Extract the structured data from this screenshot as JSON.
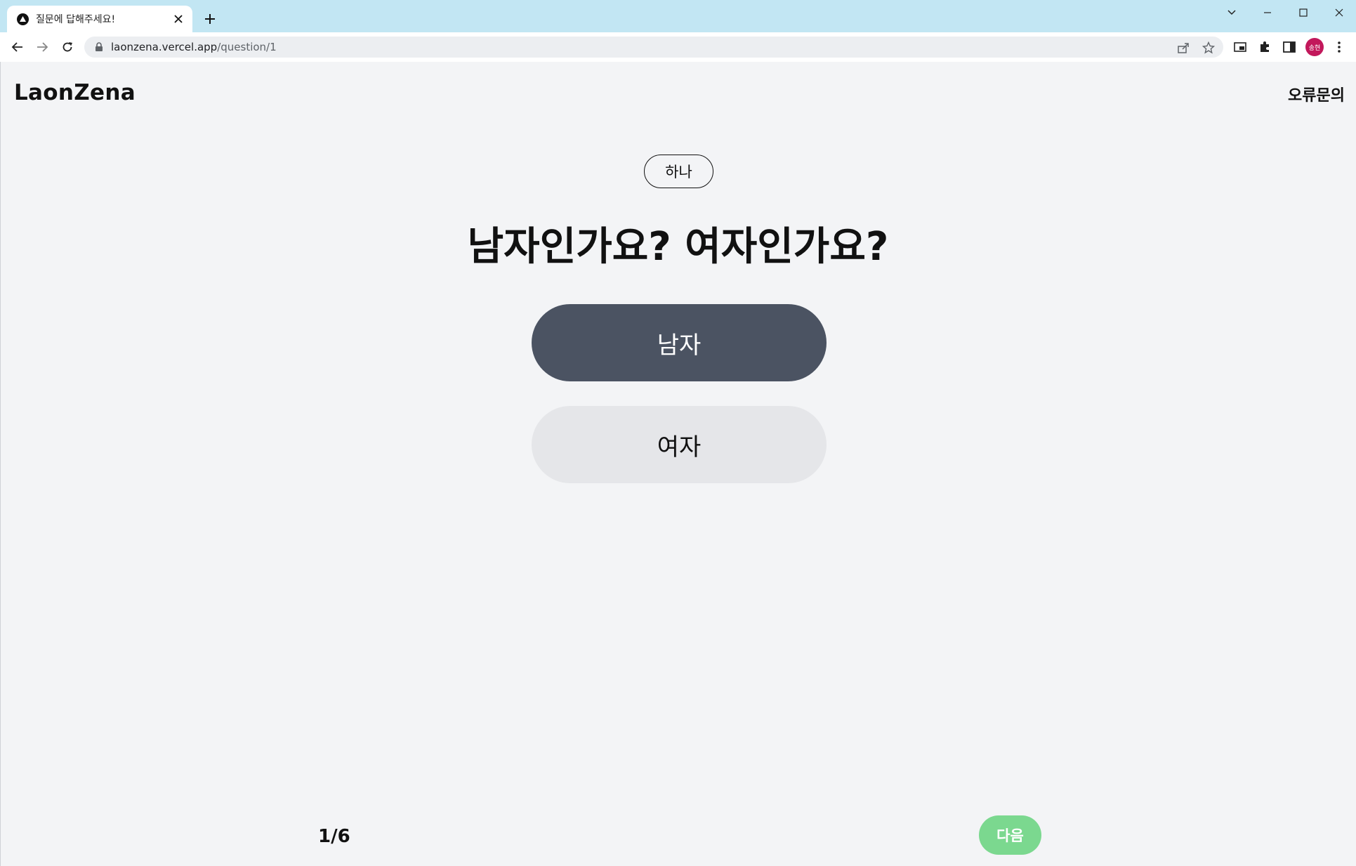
{
  "browser": {
    "tab_title": "질문에 답해주세요!",
    "url_host": "laonzena.vercel.app",
    "url_path": "/question/1",
    "profile_initials": "송현"
  },
  "header": {
    "brand": "LaonZena",
    "report_link": "오류문의"
  },
  "question": {
    "badge": "하나",
    "text": "남자인가요? 여자인가요?",
    "options": [
      {
        "label": "남자",
        "selected": true
      },
      {
        "label": "여자",
        "selected": false
      }
    ]
  },
  "footer": {
    "progress": "1/6",
    "next_label": "다음"
  },
  "colors": {
    "selected_option": "#4b5362",
    "unselected_option": "#e5e6e9",
    "next_button": "#7bd88f",
    "tabstrip": "#c2e6f3",
    "page_background": "#f3f4f6"
  }
}
